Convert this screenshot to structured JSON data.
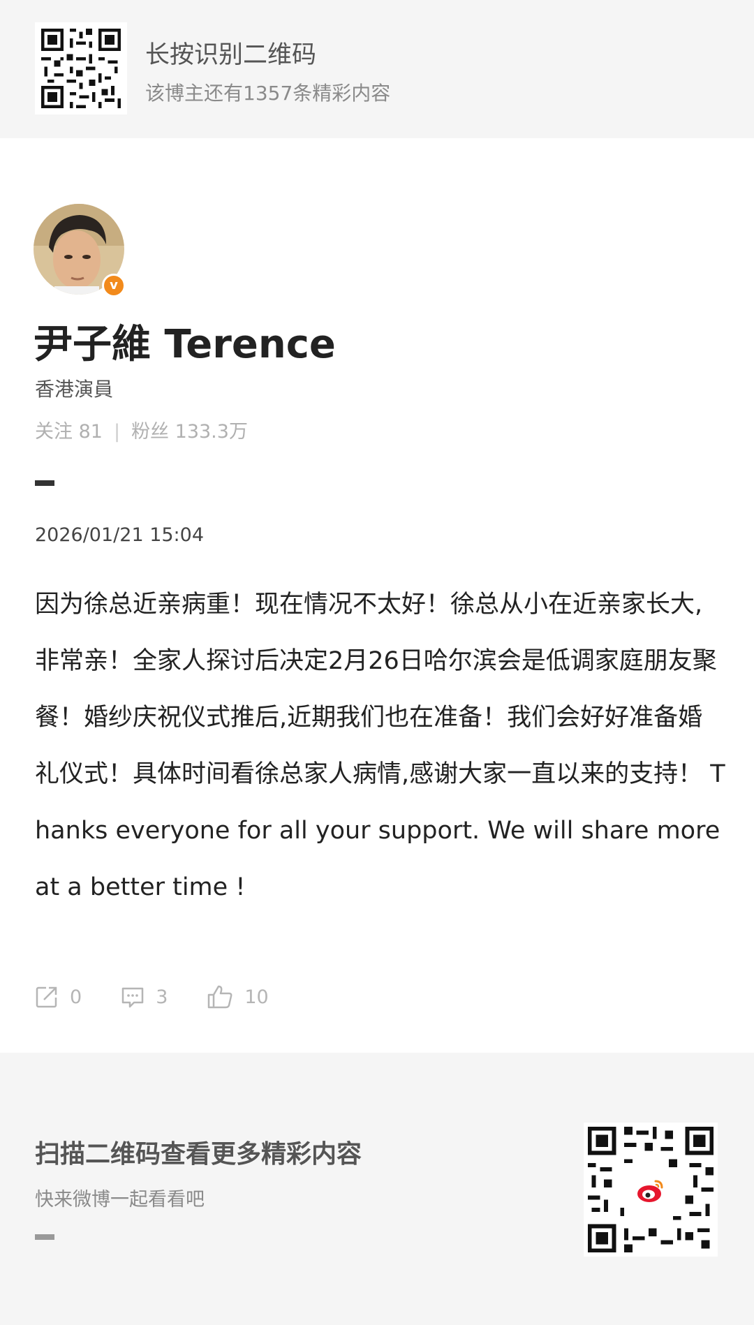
{
  "top_banner": {
    "title": "长按识别二维码",
    "subtitle": "该博主还有1357条精彩内容"
  },
  "profile": {
    "name": "尹子維 Terence",
    "description": "香港演員",
    "following_label": "关注 81",
    "followers_label": "粉丝 133.3万",
    "verified_badge": "v",
    "icon": "verified-badge-icon"
  },
  "post": {
    "timestamp": "2026/01/21 15:04",
    "text": "因为徐总近亲病重！现在情况不太好！徐总从小在近亲家长大,非常亲！全家人探讨后决定2月26日哈尔滨会是低调家庭朋友聚餐！婚纱庆祝仪式推后,近期我们也在准备！我们会好好准备婚礼仪式！具体时间看徐总家人病情,感谢大家一直以来的支持！ Thanks everyone for all your support. We will share more at a better time !"
  },
  "actions": [
    {
      "icon": "share-icon",
      "count": "0"
    },
    {
      "icon": "comment-icon",
      "count": "3"
    },
    {
      "icon": "like-icon",
      "count": "10"
    }
  ],
  "bottom": {
    "title": "扫描二维码查看更多精彩内容",
    "subtitle": "快来微博一起看看吧",
    "logo_icon": "weibo-logo-icon"
  },
  "watermark": "微博",
  "colors": {
    "accent": "#f28a1b",
    "weibo_red": "#e6162d"
  }
}
